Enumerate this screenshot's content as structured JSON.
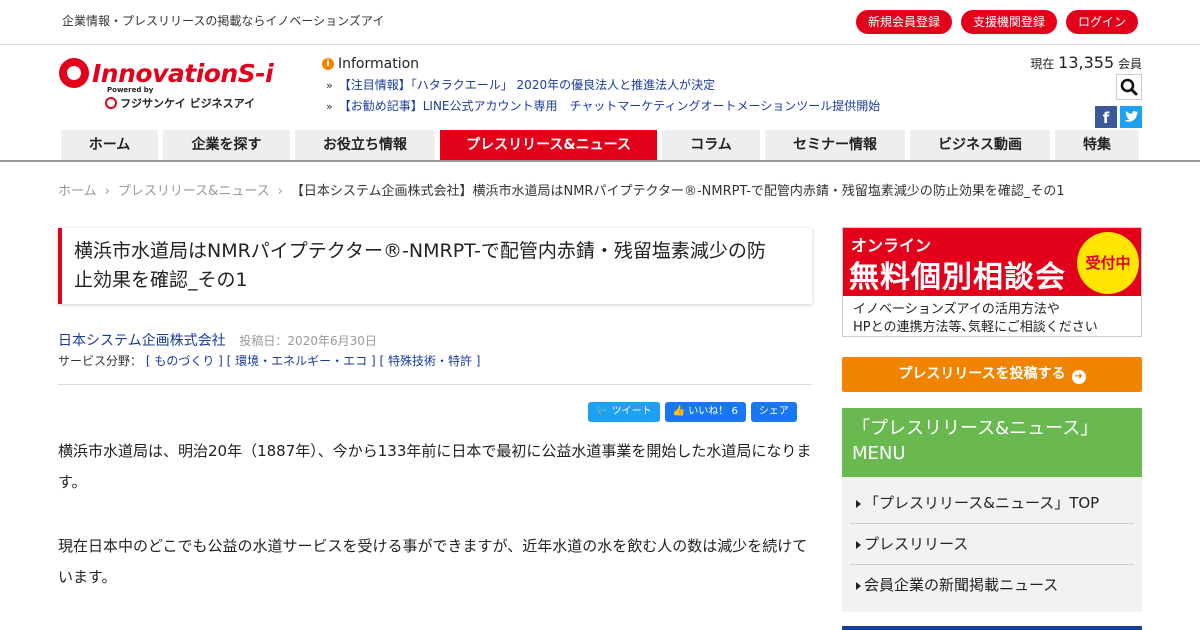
{
  "topbar": {
    "tagline": "企業情報・プレスリリースの掲載ならイノベーションズアイ",
    "buttons": [
      "新規会員登録",
      "支援機関登録",
      "ログイン"
    ]
  },
  "logo": {
    "main": "InnovationS-i",
    "powered": "Powered by",
    "sub": "フジサンケイ ビジネスアイ"
  },
  "info": {
    "heading": "Information",
    "items": [
      "【注目情報】「ハタラクエール」 2020年の優良法人と推進法人が決定",
      "【お勧め記事】LINE公式アカウント専用　チャットマーケティングオートメーションツール提供開始"
    ]
  },
  "members": {
    "prefix": "現在",
    "count": "13,355",
    "suffix": "会員"
  },
  "nav": [
    "ホーム",
    "企業を探す",
    "お役立ち情報",
    "プレスリリース&ニュース",
    "コラム",
    "セミナー情報",
    "ビジネス動画",
    "特集"
  ],
  "breadcrumb": {
    "home": "ホーム",
    "section": "プレスリリース&ニュース",
    "current": "【日本システム企画株式会社】横浜市水道局はNMRパイプテクター®-NMRPT-で配管内赤錆・残留塩素減少の防止効果を確認_その1"
  },
  "article": {
    "title_line1": "横浜市水道局はNMRパイプテクター®-NMRPT-で配管内赤錆・残留塩素減少の防",
    "title_line2": "止効果を確認_その1",
    "company": "日本システム企画株式会社",
    "post_date": "投稿日：2020年6月30日",
    "service_label": "サービス分野：",
    "tags": [
      "[ ものづくり ]",
      "[ 環境・エネルギー・エコ ]",
      "[ 特殊技術・特許 ]"
    ],
    "paragraphs": [
      "横浜市水道局は、明治20年（1887年）、今から133年前に日本で最初に公益水道事業を開始した水道局になります。",
      "現在日本中のどこでも公益の水道サービスを受ける事ができますが、近年水道の水を飲む人の数は減少を続けています。"
    ]
  },
  "share": {
    "tweet": "ツイート",
    "like": "いいね！ 6",
    "share": "シェア"
  },
  "sidebar": {
    "banner": {
      "line1": "オンライン",
      "line2": "無料個別相談会",
      "badge": "受付中",
      "desc1": "イノベーションズアイの活用方法や",
      "desc2": "HPとの連携方法等､気軽にご相談ください"
    },
    "post_button": "プレスリリースを投稿する",
    "menu_title1": "「プレスリリース&ニュース」",
    "menu_title2": "MENU",
    "menu_items": [
      "「プレスリリース&ニュース」TOP",
      "プレスリリース",
      "会員企業の新聞掲載ニュース"
    ]
  },
  "colors": {
    "brand_red": "#e3001b",
    "link_blue": "#1a3c9c",
    "orange": "#f08300",
    "green": "#6ab850"
  }
}
